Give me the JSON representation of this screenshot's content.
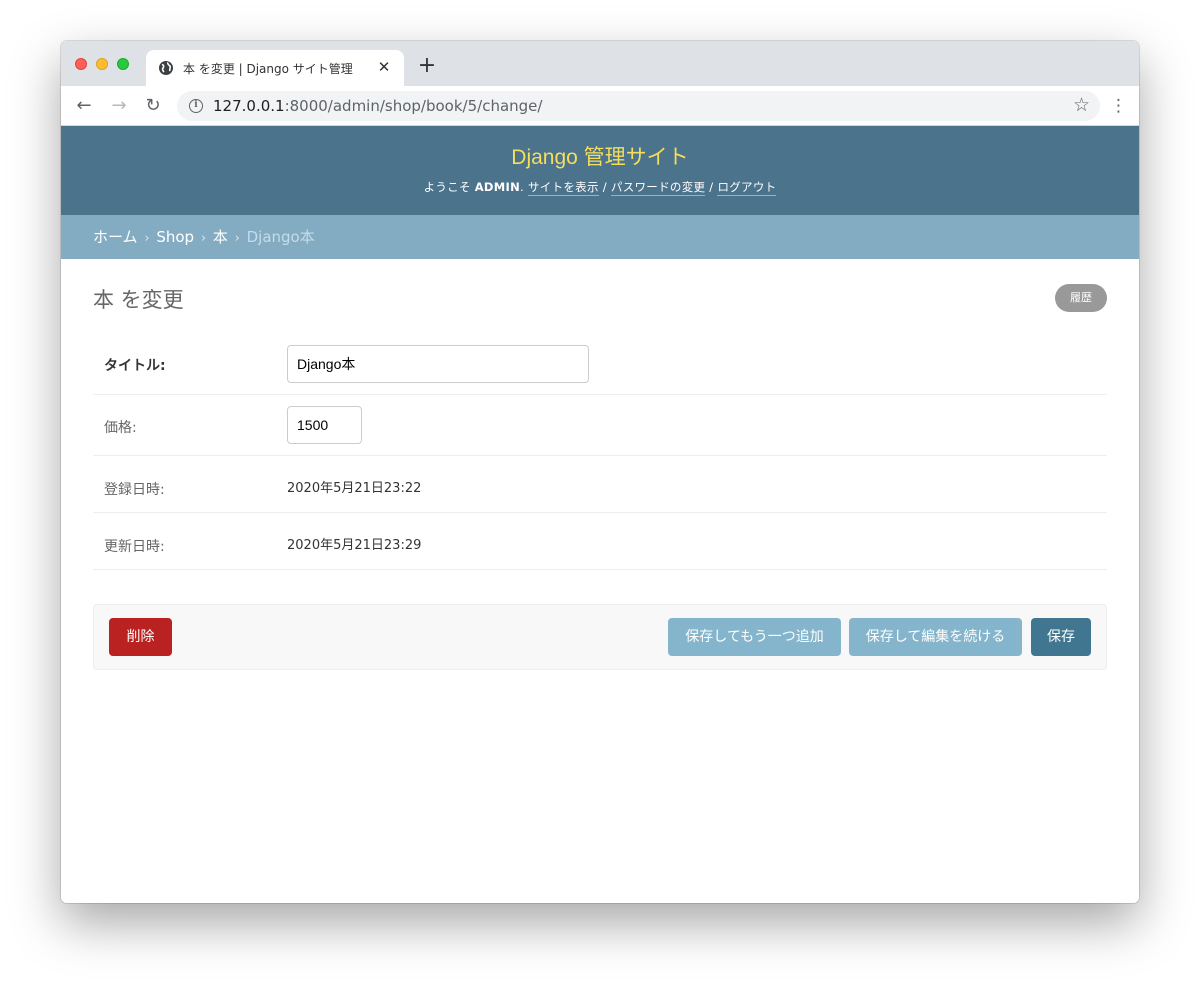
{
  "browser": {
    "tab_title": "本 を変更 | Django サイト管理",
    "tab_close": "✕",
    "new_tab": "+",
    "url_host": "127.0.0.1",
    "url_path": ":8000/admin/shop/book/5/change/",
    "back": "←",
    "forward": "→",
    "reload": "↻",
    "info": "i",
    "star": "☆",
    "menu": "⋮"
  },
  "header": {
    "branding": "Django 管理サイト",
    "welcome": "ようこそ",
    "username": "ADMIN",
    "welcome_sep": ".",
    "view_site": "サイトを表示",
    "change_password": "パスワードの変更",
    "logout": "ログアウト",
    "separator": "/"
  },
  "breadcrumbs": {
    "home": "ホーム",
    "app": "Shop",
    "model": "本",
    "current": "Django本",
    "sep": "›"
  },
  "main": {
    "title": "本 を変更",
    "history": "履歴"
  },
  "form": {
    "title_label": "タイトル:",
    "title_value": "Django本",
    "price_label": "価格:",
    "price_value": "1500",
    "created_label": "登録日時:",
    "created_value": "2020年5月21日23:22",
    "updated_label": "更新日時:",
    "updated_value": "2020年5月21日23:29"
  },
  "actions": {
    "delete": "削除",
    "save_add_another": "保存してもう一つ追加",
    "save_continue": "保存して編集を続ける",
    "save": "保存"
  }
}
